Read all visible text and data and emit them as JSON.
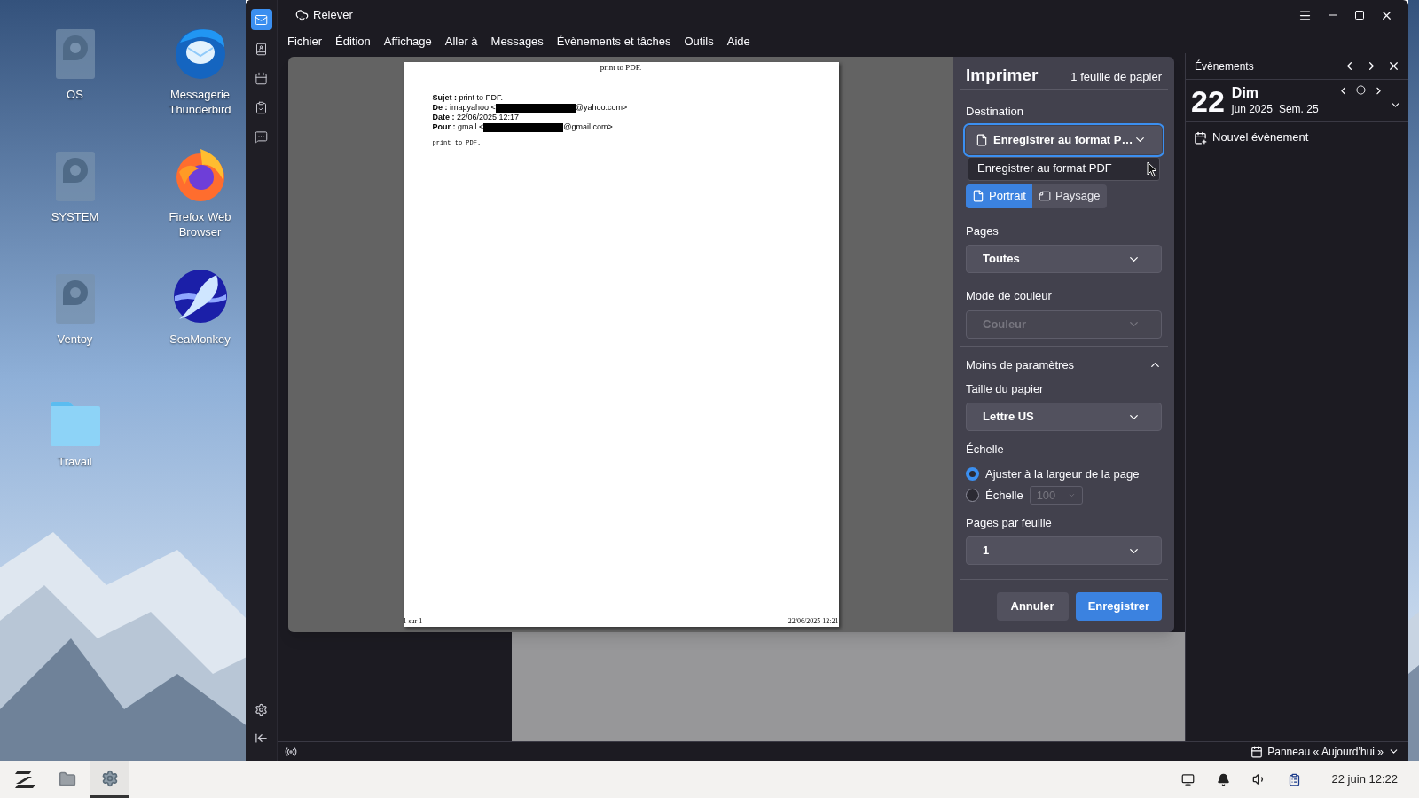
{
  "desktop": {
    "icons": [
      {
        "label": "OS",
        "kind": "drive"
      },
      {
        "label": "Messagerie Thunderbird",
        "kind": "mail"
      },
      {
        "label": "SYSTEM",
        "kind": "drive"
      },
      {
        "label": "Firefox Web Browser",
        "kind": "browser"
      },
      {
        "label": "Ventoy",
        "kind": "drive"
      },
      {
        "label": "SeaMonkey",
        "kind": "suite"
      },
      {
        "label": "Travail",
        "kind": "folder"
      }
    ]
  },
  "window": {
    "title": "Relever",
    "menu": [
      "Fichier",
      "Édition",
      "Affichage",
      "Aller à",
      "Messages",
      "Évènements et tâches",
      "Outils",
      "Aide"
    ],
    "spaces": [
      {
        "kind": "mail",
        "selected": true
      },
      {
        "kind": "contacts",
        "selected": false
      },
      {
        "kind": "calendar",
        "selected": false
      },
      {
        "kind": "tasks",
        "selected": false
      },
      {
        "kind": "chat",
        "selected": false
      }
    ]
  },
  "print_preview": {
    "header": "print to PDF.",
    "fields": [
      {
        "label": "Sujet :",
        "before": "print to PDF.",
        "redacted": false
      },
      {
        "label": "De :",
        "before": "imapyahoo <",
        "redacted": true,
        "after": "@yahoo.com>"
      },
      {
        "label": "Date :",
        "before": "22/06/2025 12:17",
        "redacted": false
      },
      {
        "label": "Pour :",
        "before": "gmail <",
        "redacted": true,
        "after": "@gmail.com>"
      }
    ],
    "body": "print to PDF.",
    "footer_left": "1 sur 1",
    "footer_right": "22/06/2025 12:21"
  },
  "print_panel": {
    "title": "Imprimer",
    "sheet_count": "1 feuille de papier",
    "destination": {
      "label": "Destination",
      "value": "Enregistrer au format P…",
      "expanded": true,
      "options": [
        "Enregistrer au format PDF"
      ]
    },
    "orientation": [
      {
        "label": "Portrait",
        "selected": true
      },
      {
        "label": "Paysage",
        "selected": false
      }
    ],
    "pages": {
      "label": "Pages",
      "value": "Toutes",
      "disabled": false
    },
    "color_mode": {
      "label": "Mode de couleur",
      "value": "Couleur",
      "disabled": true
    },
    "more_settings": {
      "label": "Moins de paramètres",
      "expanded": true
    },
    "paper_size": {
      "label": "Taille du papier",
      "value": "Lettre US",
      "disabled": false
    },
    "scale": {
      "label": "Échelle",
      "options": [
        {
          "label": "Ajuster à la largeur de la page",
          "selected": true
        },
        {
          "label": "Échelle",
          "selected": false,
          "value": "100"
        }
      ]
    },
    "pages_per_sheet": {
      "label": "Pages par feuille",
      "value": "1",
      "disabled": false
    },
    "buttons": [
      {
        "label": "Annuler",
        "kind": "secondary"
      },
      {
        "label": "Enregistrer",
        "kind": "primary"
      }
    ]
  },
  "events_panel": {
    "title": "Évènements",
    "day": "22",
    "weekday": "Dim",
    "month_year": "jun 2025",
    "week": "Sem. 25",
    "new_event": "Nouvel évènement"
  },
  "status_bar": {
    "today_pane": "Panneau « Aujourd’hui »"
  },
  "taskbar": {
    "apps": [
      {
        "kind": "menu",
        "selected": false
      },
      {
        "kind": "files",
        "selected": false
      },
      {
        "kind": "settings",
        "selected": true
      }
    ],
    "clock": "22 juin 12:22"
  }
}
